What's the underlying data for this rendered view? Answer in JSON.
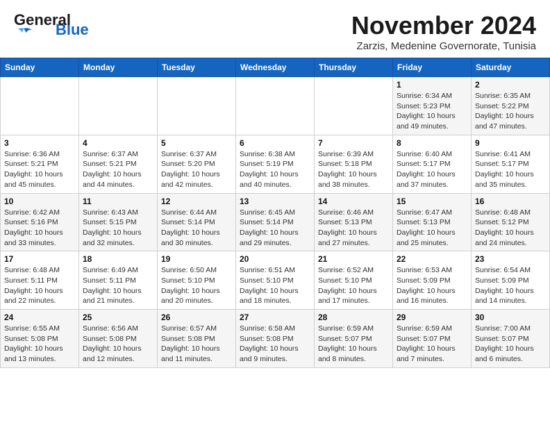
{
  "header": {
    "logo_line1": "General",
    "logo_line2": "Blue",
    "month": "November 2024",
    "location": "Zarzis, Medenine Governorate, Tunisia"
  },
  "weekdays": [
    "Sunday",
    "Monday",
    "Tuesday",
    "Wednesday",
    "Thursday",
    "Friday",
    "Saturday"
  ],
  "weeks": [
    [
      {
        "day": "",
        "info": ""
      },
      {
        "day": "",
        "info": ""
      },
      {
        "day": "",
        "info": ""
      },
      {
        "day": "",
        "info": ""
      },
      {
        "day": "",
        "info": ""
      },
      {
        "day": "1",
        "info": "Sunrise: 6:34 AM\nSunset: 5:23 PM\nDaylight: 10 hours\nand 49 minutes."
      },
      {
        "day": "2",
        "info": "Sunrise: 6:35 AM\nSunset: 5:22 PM\nDaylight: 10 hours\nand 47 minutes."
      }
    ],
    [
      {
        "day": "3",
        "info": "Sunrise: 6:36 AM\nSunset: 5:21 PM\nDaylight: 10 hours\nand 45 minutes."
      },
      {
        "day": "4",
        "info": "Sunrise: 6:37 AM\nSunset: 5:21 PM\nDaylight: 10 hours\nand 44 minutes."
      },
      {
        "day": "5",
        "info": "Sunrise: 6:37 AM\nSunset: 5:20 PM\nDaylight: 10 hours\nand 42 minutes."
      },
      {
        "day": "6",
        "info": "Sunrise: 6:38 AM\nSunset: 5:19 PM\nDaylight: 10 hours\nand 40 minutes."
      },
      {
        "day": "7",
        "info": "Sunrise: 6:39 AM\nSunset: 5:18 PM\nDaylight: 10 hours\nand 38 minutes."
      },
      {
        "day": "8",
        "info": "Sunrise: 6:40 AM\nSunset: 5:17 PM\nDaylight: 10 hours\nand 37 minutes."
      },
      {
        "day": "9",
        "info": "Sunrise: 6:41 AM\nSunset: 5:17 PM\nDaylight: 10 hours\nand 35 minutes."
      }
    ],
    [
      {
        "day": "10",
        "info": "Sunrise: 6:42 AM\nSunset: 5:16 PM\nDaylight: 10 hours\nand 33 minutes."
      },
      {
        "day": "11",
        "info": "Sunrise: 6:43 AM\nSunset: 5:15 PM\nDaylight: 10 hours\nand 32 minutes."
      },
      {
        "day": "12",
        "info": "Sunrise: 6:44 AM\nSunset: 5:14 PM\nDaylight: 10 hours\nand 30 minutes."
      },
      {
        "day": "13",
        "info": "Sunrise: 6:45 AM\nSunset: 5:14 PM\nDaylight: 10 hours\nand 29 minutes."
      },
      {
        "day": "14",
        "info": "Sunrise: 6:46 AM\nSunset: 5:13 PM\nDaylight: 10 hours\nand 27 minutes."
      },
      {
        "day": "15",
        "info": "Sunrise: 6:47 AM\nSunset: 5:13 PM\nDaylight: 10 hours\nand 25 minutes."
      },
      {
        "day": "16",
        "info": "Sunrise: 6:48 AM\nSunset: 5:12 PM\nDaylight: 10 hours\nand 24 minutes."
      }
    ],
    [
      {
        "day": "17",
        "info": "Sunrise: 6:48 AM\nSunset: 5:11 PM\nDaylight: 10 hours\nand 22 minutes."
      },
      {
        "day": "18",
        "info": "Sunrise: 6:49 AM\nSunset: 5:11 PM\nDaylight: 10 hours\nand 21 minutes."
      },
      {
        "day": "19",
        "info": "Sunrise: 6:50 AM\nSunset: 5:10 PM\nDaylight: 10 hours\nand 20 minutes."
      },
      {
        "day": "20",
        "info": "Sunrise: 6:51 AM\nSunset: 5:10 PM\nDaylight: 10 hours\nand 18 minutes."
      },
      {
        "day": "21",
        "info": "Sunrise: 6:52 AM\nSunset: 5:10 PM\nDaylight: 10 hours\nand 17 minutes."
      },
      {
        "day": "22",
        "info": "Sunrise: 6:53 AM\nSunset: 5:09 PM\nDaylight: 10 hours\nand 16 minutes."
      },
      {
        "day": "23",
        "info": "Sunrise: 6:54 AM\nSunset: 5:09 PM\nDaylight: 10 hours\nand 14 minutes."
      }
    ],
    [
      {
        "day": "24",
        "info": "Sunrise: 6:55 AM\nSunset: 5:08 PM\nDaylight: 10 hours\nand 13 minutes."
      },
      {
        "day": "25",
        "info": "Sunrise: 6:56 AM\nSunset: 5:08 PM\nDaylight: 10 hours\nand 12 minutes."
      },
      {
        "day": "26",
        "info": "Sunrise: 6:57 AM\nSunset: 5:08 PM\nDaylight: 10 hours\nand 11 minutes."
      },
      {
        "day": "27",
        "info": "Sunrise: 6:58 AM\nSunset: 5:08 PM\nDaylight: 10 hours\nand 9 minutes."
      },
      {
        "day": "28",
        "info": "Sunrise: 6:59 AM\nSunset: 5:07 PM\nDaylight: 10 hours\nand 8 minutes."
      },
      {
        "day": "29",
        "info": "Sunrise: 6:59 AM\nSunset: 5:07 PM\nDaylight: 10 hours\nand 7 minutes."
      },
      {
        "day": "30",
        "info": "Sunrise: 7:00 AM\nSunset: 5:07 PM\nDaylight: 10 hours\nand 6 minutes."
      }
    ]
  ]
}
